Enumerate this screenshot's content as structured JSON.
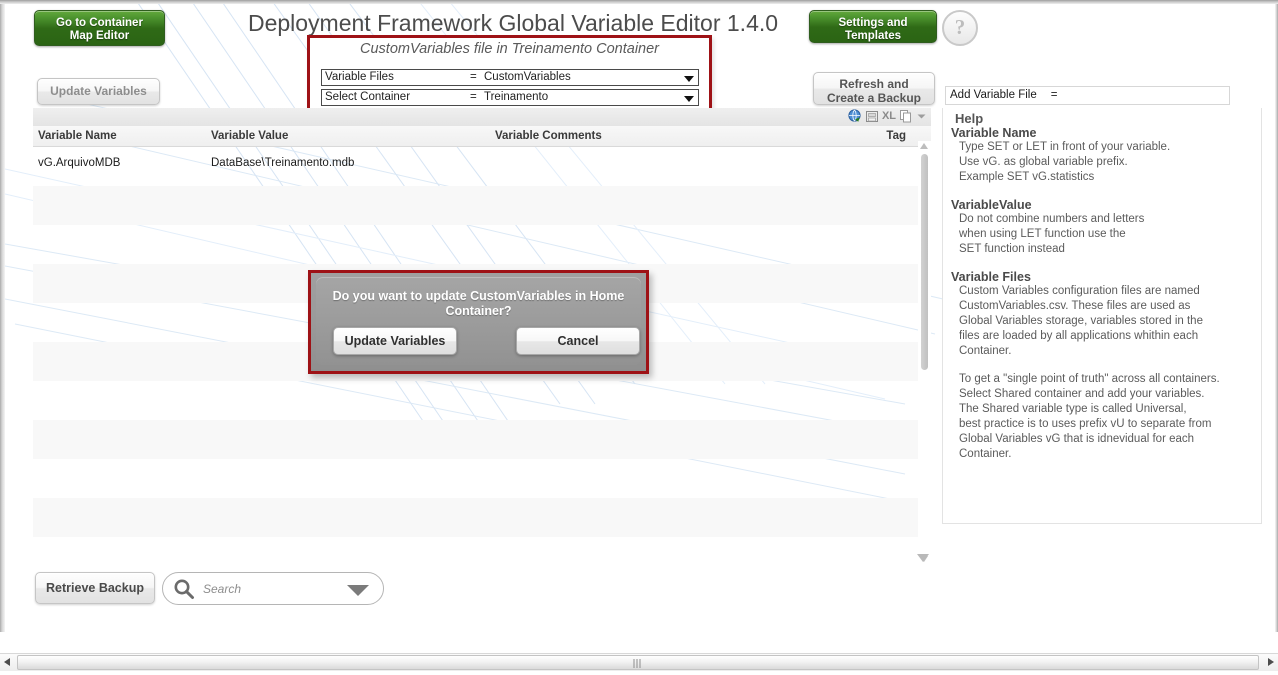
{
  "header": {
    "title": "Deployment Framework Global Variable Editor 1.4.0",
    "go_to_map_label": "Go to Container\nMap Editor",
    "settings_label": "Settings and\nTemplates",
    "help_glyph": "?",
    "update_variables_label": "Update Variables",
    "refresh_backup_label": "Refresh and\nCreate a Backup"
  },
  "selector": {
    "caption": "CustomVariables file in Treinamento Container",
    "rows": [
      {
        "label": "Variable Files",
        "eq": "=",
        "value": "CustomVariables"
      },
      {
        "label": "Select Container",
        "eq": "=",
        "value": "Treinamento"
      }
    ]
  },
  "table": {
    "toolbar_icons": [
      "export-web-icon",
      "export-print-icon",
      "export-excel-icon",
      "copy-icon",
      "more-options-icon"
    ],
    "columns": [
      "Variable Name",
      "Variable Value",
      "Variable Comments",
      "Tag"
    ],
    "rows": [
      {
        "name": "vG.ArquivoMDB",
        "value": "DataBase\\Treinamento.mdb",
        "comments": "",
        "tag": ""
      },
      {
        "name": "",
        "value": "",
        "comments": "",
        "tag": ""
      },
      {
        "name": "",
        "value": "",
        "comments": "",
        "tag": ""
      },
      {
        "name": "",
        "value": "",
        "comments": "",
        "tag": ""
      },
      {
        "name": "",
        "value": "",
        "comments": "",
        "tag": ""
      },
      {
        "name": "",
        "value": "",
        "comments": "",
        "tag": ""
      },
      {
        "name": "",
        "value": "",
        "comments": "",
        "tag": ""
      },
      {
        "name": "",
        "value": "",
        "comments": "",
        "tag": ""
      },
      {
        "name": "",
        "value": "",
        "comments": "",
        "tag": ""
      },
      {
        "name": "",
        "value": "",
        "comments": "",
        "tag": ""
      },
      {
        "name": "",
        "value": "",
        "comments": "",
        "tag": ""
      }
    ]
  },
  "footer": {
    "retrieve_backup_label": "Retrieve Backup",
    "search_placeholder": "Search"
  },
  "add_file": {
    "label": "Add Variable File",
    "eq": "="
  },
  "help": {
    "title": "Help",
    "sections": [
      {
        "heading": "Variable Name",
        "body": "Type SET or LET in front of your variable.\nUse vG. as global variable prefix.\nExample SET vG.statistics"
      },
      {
        "heading": "VariableValue",
        "body": "Do not combine numbers and letters\nwhen using LET function use the\nSET function instead"
      },
      {
        "heading": "Variable Files",
        "body": "Custom Variables configuration files are named\nCustomVariables.csv. These files are used as\nGlobal Variables storage, variables stored in the\nfiles are loaded by all applications whithin each\nContainer.",
        "body2": "To get a \"single point of truth\" across all containers.\nSelect Shared container and add your variables.\nThe Shared variable type is called Universal,\nbest practice is to uses prefix vU to separate from\nGlobal Variables vG that is idnevidual for each\nContainer."
      }
    ]
  },
  "dialog": {
    "message": "Do you want to update CustomVariables in Home Container?",
    "confirm_label": "Update Variables",
    "cancel_label": "Cancel"
  },
  "colors": {
    "brand_green": "#2f6a16",
    "alert_red": "#9e1216",
    "panel_gray": "#9b9b9b",
    "accent_blue": "#cfe0f2"
  }
}
